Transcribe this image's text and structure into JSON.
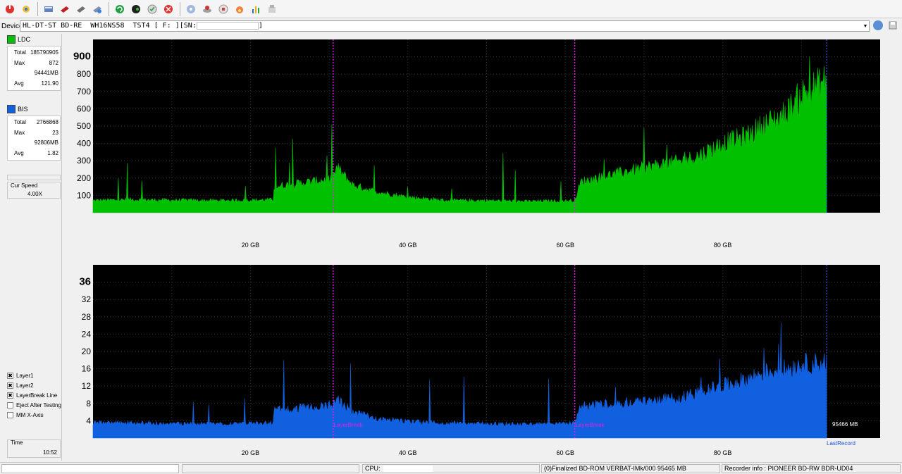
{
  "device": {
    "label": "Device:",
    "value": "HL-DT-ST BD-RE  WH16NS58  TST4 [ F: ][SN:",
    "close_bracket": "]"
  },
  "toolbar": {
    "icons": [
      "power-icon",
      "settings-icon",
      "drive-info-icon",
      "disc-red-icon",
      "disc-gray-icon",
      "disc-info-icon",
      "refresh-icon",
      "eject-icon",
      "verify-icon",
      "stop-icon",
      "blank-disc-icon",
      "burn-icon",
      "copy-icon",
      "flame-icon",
      "chart-icon",
      "save-icon"
    ]
  },
  "ldc": {
    "name": "LDC",
    "color": "#00c000",
    "total_label": "Total",
    "total": "185790905",
    "max_label": "Max",
    "max": "872",
    "max_pos": "94441MB",
    "avg_label": "Avg",
    "avg": "121.90"
  },
  "bis": {
    "name": "BIS",
    "color": "#1060e0",
    "total_label": "Total",
    "total": "2766868",
    "max_label": "Max",
    "max": "23",
    "max_pos": "92806MB",
    "avg_label": "Avg",
    "avg": "1.82"
  },
  "cur_speed": {
    "label": "Cur Speed",
    "value": "4.00X"
  },
  "options": [
    {
      "label": "Layer1",
      "checked": true
    },
    {
      "label": "Layer2",
      "checked": true
    },
    {
      "label": "LayerBreak Line",
      "checked": true
    },
    {
      "label": "Eject After Testing",
      "checked": false
    },
    {
      "label": "MM X-Axis",
      "checked": false
    }
  ],
  "time": {
    "label": "Time",
    "value": "10:52"
  },
  "status": {
    "cpu": "CPU:",
    "disc": "(0)Finalized  BD-ROM  VERBAT-IMk/000  95465 MB",
    "recorder": "Recorder info : PIONEER     BD-RW  BDR-UD04"
  },
  "chart_data": [
    {
      "type": "area",
      "name": "LDC",
      "x_ticks": [
        "20 GB",
        "40 GB",
        "60 GB",
        "80 GB"
      ],
      "y_ticks": [
        "100",
        "200",
        "300",
        "400",
        "500",
        "600",
        "700",
        "800",
        "900"
      ],
      "x_range_gb": [
        0,
        100
      ],
      "ylim": [
        0,
        1000
      ],
      "color": "#00c000",
      "layer_breaks_gb": [
        30.5,
        61.2
      ],
      "last_record_gb": 93.2,
      "x_gb": [
        0,
        5,
        10,
        15,
        20,
        22.9,
        23,
        27,
        30.4,
        31,
        33,
        36,
        40,
        45,
        50,
        55,
        60,
        61.2,
        62,
        66,
        70,
        75,
        77,
        80,
        83,
        85,
        88,
        90,
        93.2
      ],
      "values": [
        70,
        75,
        72,
        70,
        72,
        75,
        150,
        175,
        195,
        260,
        160,
        120,
        90,
        70,
        70,
        65,
        68,
        70,
        180,
        220,
        260,
        300,
        330,
        400,
        440,
        500,
        570,
        680,
        760
      ]
    },
    {
      "type": "area",
      "name": "BIS",
      "x_ticks": [
        "20 GB",
        "40 GB",
        "60 GB",
        "80 GB"
      ],
      "y_ticks": [
        "4",
        "8",
        "12",
        "16",
        "20",
        "24",
        "28",
        "32",
        "36"
      ],
      "x_range_gb": [
        0,
        100
      ],
      "ylim": [
        0,
        40
      ],
      "color": "#1060e0",
      "layer_breaks_gb": [
        30.5,
        61.2
      ],
      "layer_break_label": "LayerBreak",
      "last_record_gb": 93.2,
      "last_record_label": "LastRecord",
      "end_label": "95466 MB",
      "x_gb": [
        0,
        5,
        10,
        15,
        20,
        22.9,
        23,
        27,
        30.4,
        31,
        33,
        36,
        40,
        45,
        50,
        55,
        60,
        61.2,
        62,
        66,
        70,
        75,
        77,
        80,
        83,
        85,
        88,
        90,
        93.2
      ],
      "values": [
        3.5,
        3.5,
        3.3,
        3.3,
        3.4,
        3.5,
        6.5,
        7,
        7.5,
        9,
        6,
        4.5,
        3.8,
        3.4,
        3.3,
        3.2,
        3.3,
        3.5,
        7.5,
        8,
        8.5,
        9.5,
        10.5,
        12,
        13.5,
        15,
        16,
        17,
        17.5
      ]
    }
  ]
}
